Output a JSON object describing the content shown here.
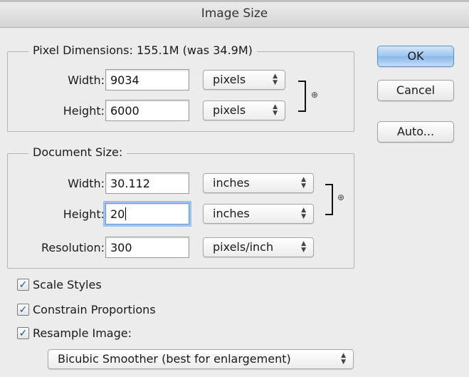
{
  "window": {
    "title": "Image Size"
  },
  "pixel_dimensions": {
    "legend": "Pixel Dimensions:  155.1M (was 34.9M)",
    "width_label": "Width:",
    "width_value": "9034",
    "width_unit": "pixels",
    "height_label": "Height:",
    "height_value": "6000",
    "height_unit": "pixels"
  },
  "document_size": {
    "legend": "Document Size:",
    "width_label": "Width:",
    "width_value": "30.112",
    "width_unit": "inches",
    "height_label": "Height:",
    "height_value": "20",
    "height_unit": "inches",
    "resolution_label": "Resolution:",
    "resolution_value": "300",
    "resolution_unit": "pixels/inch"
  },
  "buttons": {
    "ok": "OK",
    "cancel": "Cancel",
    "auto": "Auto..."
  },
  "options": {
    "scale_styles": {
      "label": "Scale Styles",
      "checked": true
    },
    "constrain_proportions": {
      "label": "Constrain Proportions",
      "checked": true
    },
    "resample_image": {
      "label": "Resample Image:",
      "checked": true
    }
  },
  "resample_method": {
    "value": "Bicubic Smoother (best for enlargement)"
  },
  "icons": {
    "link": "chain-link-icon",
    "popup_arrows": "up-down-arrows-icon",
    "check": "checkmark-icon"
  },
  "colors": {
    "default_button": "#9bc4ee",
    "focus_ring": "#9ec2ef",
    "checkmark": "#1a4f9c"
  }
}
